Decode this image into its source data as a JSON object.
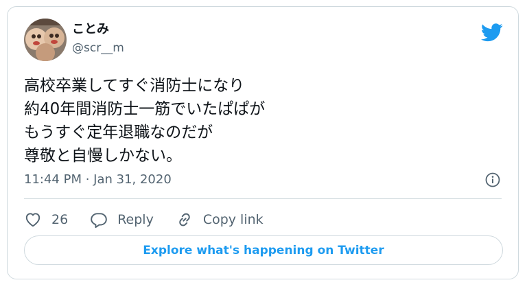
{
  "author": {
    "display_name": "ことみ",
    "handle": "@scr__m"
  },
  "tweet": {
    "lines": [
      "高校卒業してすぐ消防士になり",
      "約40年間消防士一筋でいたぱぱが",
      "もうすぐ定年退職なのだが",
      "尊敬と自慢しかない。"
    ]
  },
  "meta": {
    "timestamp": "11:44 PM · Jan 31, 2020"
  },
  "actions": {
    "like_count": "26",
    "reply_label": "Reply",
    "copy_link_label": "Copy link"
  },
  "explore_button": {
    "label": "Explore what's happening on Twitter"
  },
  "colors": {
    "accent": "#1d9bf0",
    "secondary_text": "#536471",
    "border": "#cfd9de"
  },
  "icons": [
    "twitter-bird-icon",
    "info-icon",
    "heart-icon",
    "reply-icon",
    "link-icon"
  ]
}
